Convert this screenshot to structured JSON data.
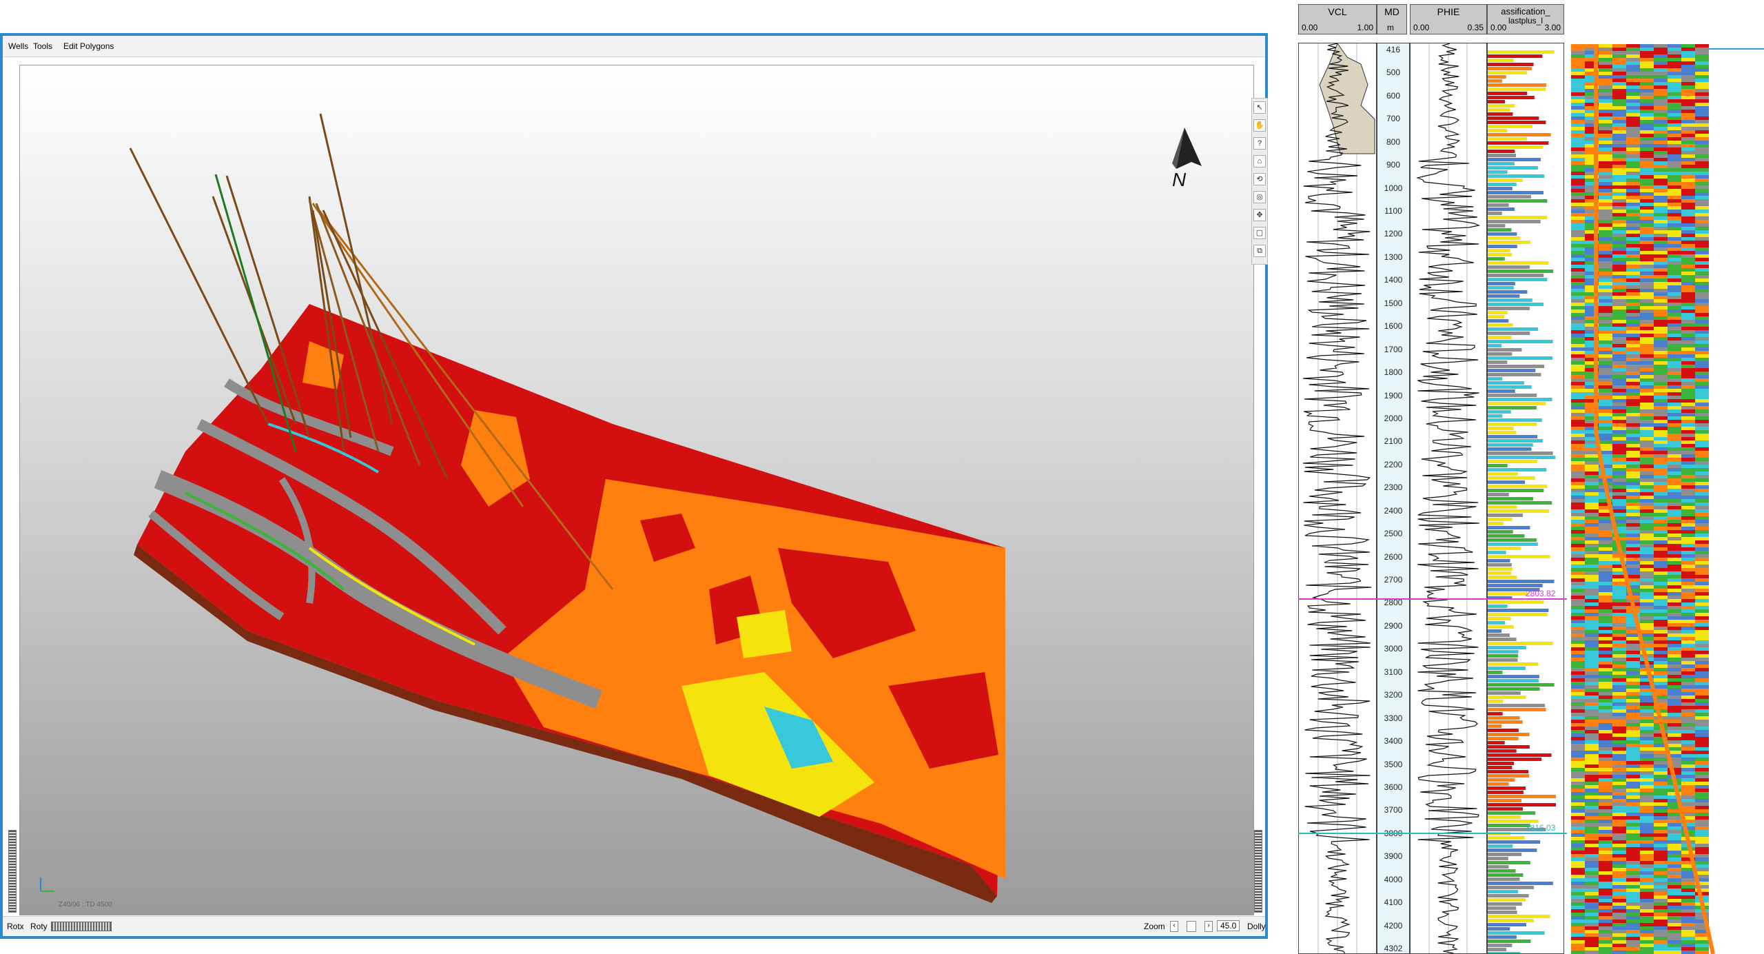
{
  "menu": {
    "items": [
      "Wells",
      "Tools",
      "Edit Polygons"
    ]
  },
  "toolbar": {
    "tools": [
      "pointer-icon",
      "pan-icon",
      "query-icon",
      "home-icon",
      "rotate-icon",
      "zoom-icon",
      "move-icon",
      "select-icon",
      "save-view-icon"
    ],
    "glyphs": [
      "↖",
      "✋",
      "?",
      "⌂",
      "⟲",
      "◎",
      "✥",
      "▢",
      "⧉"
    ]
  },
  "north_arrow": {
    "label": "N"
  },
  "coord_readout": {
    "text": "Z40/06 : TD 4500"
  },
  "status": {
    "rotx": "Rotx",
    "roty": "Roty",
    "zoom_label": "Zoom",
    "zoom_value": "45.0",
    "dolly": "Dolly"
  },
  "well_log": {
    "headers": [
      {
        "name": "VCL",
        "min": "0.00",
        "max": "1.00"
      },
      {
        "name": "MD",
        "unit": "m"
      },
      {
        "name": "PHIE",
        "min": "0.00",
        "max": "0.35"
      },
      {
        "name": "assification_",
        "sub": "lastplus_l",
        "min": "0.00",
        "max": "3.00"
      }
    ],
    "depth_labels": [
      "416",
      "500",
      "600",
      "700",
      "800",
      "900",
      "1000",
      "1100",
      "1200",
      "1300",
      "1400",
      "1500",
      "1600",
      "1700",
      "1800",
      "1900",
      "2000",
      "2100",
      "2200",
      "2300",
      "2400",
      "2500",
      "2600",
      "2700",
      "2800",
      "2900",
      "3000",
      "3100",
      "3200",
      "3300",
      "3400",
      "3500",
      "3600",
      "3700",
      "3800",
      "3900",
      "4000",
      "4100",
      "4200",
      "4302"
    ],
    "markers": [
      {
        "label": "2803.82",
        "color": "#d23ad2"
      },
      {
        "label": "3816.03",
        "color": "#24b8c8"
      }
    ]
  },
  "colors": {
    "accent": "#2a8ad0",
    "facies_red": "#d40f0f",
    "facies_orange": "#ff7f0f",
    "facies_yellow": "#f5e30d",
    "facies_green": "#3cb43c",
    "facies_gray": "#8e8e8e",
    "facies_cyan": "#36c7d8"
  }
}
